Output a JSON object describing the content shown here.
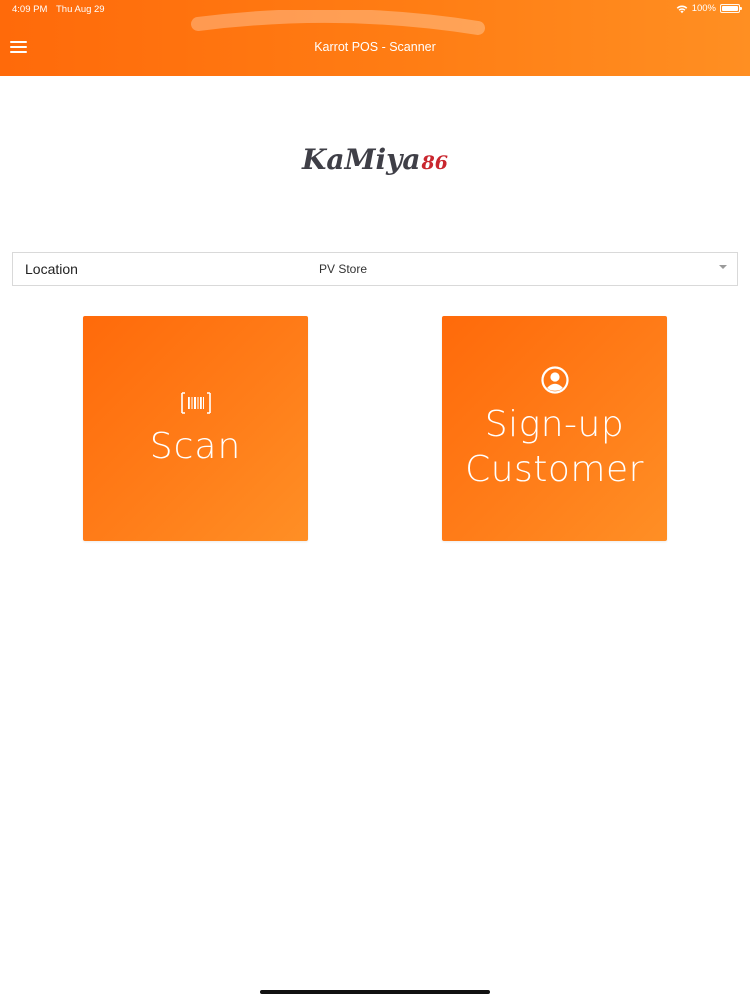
{
  "status_bar": {
    "time": "4:09 PM",
    "date": "Thu Aug 29",
    "battery": "100%"
  },
  "header": {
    "title": "Karrot POS - Scanner",
    "menu_icon": "hamburger-menu-icon"
  },
  "logo": {
    "main": "KaMiya",
    "num": "86"
  },
  "location": {
    "label": "Location",
    "value": "PV Store"
  },
  "tiles": {
    "scan": {
      "label": "Scan",
      "icon": "barcode-icon"
    },
    "signup": {
      "label_line1": "Sign-up",
      "label_line2": "Customer",
      "icon": "user-circle-icon"
    }
  },
  "colors": {
    "primary": "#ff7410",
    "logo_red": "#c9262e",
    "logo_dark": "#3f3f47"
  }
}
